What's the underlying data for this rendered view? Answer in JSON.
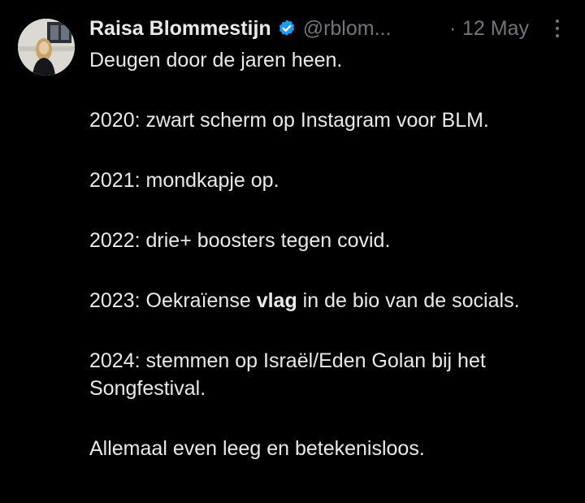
{
  "author": {
    "display_name": "Raisa Blommestijn",
    "handle": "@rblom...",
    "verified": true
  },
  "meta": {
    "separator": "·",
    "date": "12 May"
  },
  "icons": {
    "verified": "verified-badge-icon",
    "more": "more-options-icon"
  },
  "colors": {
    "background": "#000000",
    "text": "#e7e9ea",
    "muted": "#71767b",
    "verified_blue": "#1d9bf0"
  },
  "body": {
    "line1": "Deugen door de jaren heen.",
    "line2020": "2020: zwart scherm op Instagram voor BLM.",
    "line2021": "2021: mondkapje op.",
    "line2022": "2022: drie+ boosters tegen covid.",
    "line2023_pre": "2023: Oekraïense ",
    "line2023_bold": "vlag",
    "line2023_post": " in de bio van de socials.",
    "line2024": "2024: stemmen op Israël/Eden Golan bij het Songfestival.",
    "closing": "Allemaal even leeg en betekenisloos."
  }
}
